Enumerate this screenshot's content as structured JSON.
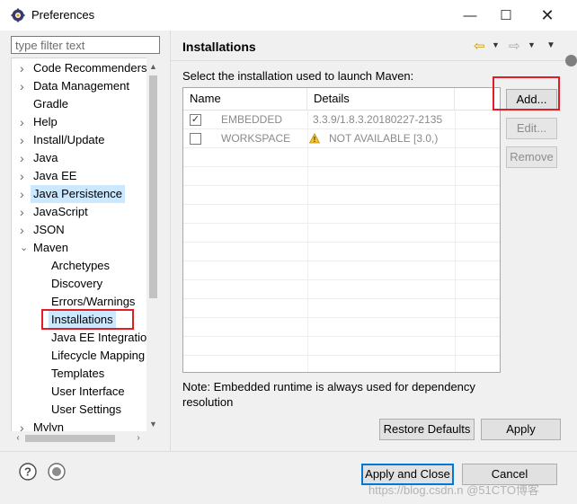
{
  "window": {
    "title": "Preferences",
    "app_icon": "gear-icon",
    "controls": {
      "minimize": "—",
      "maximize": "☐",
      "close": "✕"
    }
  },
  "filter": {
    "placeholder": "type filter text",
    "value": ""
  },
  "tree": {
    "items": [
      {
        "label": "Code Recommenders",
        "level": 0,
        "expandable": true,
        "expanded": false
      },
      {
        "label": "Data Management",
        "level": 0,
        "expandable": true,
        "expanded": false
      },
      {
        "label": "Gradle",
        "level": 0,
        "expandable": false
      },
      {
        "label": "Help",
        "level": 0,
        "expandable": true,
        "expanded": false
      },
      {
        "label": "Install/Update",
        "level": 0,
        "expandable": true,
        "expanded": false
      },
      {
        "label": "Java",
        "level": 0,
        "expandable": true,
        "expanded": false
      },
      {
        "label": "Java EE",
        "level": 0,
        "expandable": true,
        "expanded": false
      },
      {
        "label": "Java Persistence",
        "level": 0,
        "expandable": true,
        "expanded": false,
        "highlighted": true
      },
      {
        "label": "JavaScript",
        "level": 0,
        "expandable": true,
        "expanded": false
      },
      {
        "label": "JSON",
        "level": 0,
        "expandable": true,
        "expanded": false
      },
      {
        "label": "Maven",
        "level": 0,
        "expandable": true,
        "expanded": true
      },
      {
        "label": "Archetypes",
        "level": 1
      },
      {
        "label": "Discovery",
        "level": 1
      },
      {
        "label": "Errors/Warnings",
        "level": 1
      },
      {
        "label": "Installations",
        "level": 1,
        "selected": true
      },
      {
        "label": "Java EE Integration",
        "level": 1
      },
      {
        "label": "Lifecycle Mapping",
        "level": 1
      },
      {
        "label": "Templates",
        "level": 1
      },
      {
        "label": "User Interface",
        "level": 1
      },
      {
        "label": "User Settings",
        "level": 1
      },
      {
        "label": "Mylyn",
        "level": 0,
        "expandable": true,
        "expanded": false
      }
    ]
  },
  "page": {
    "title": "Installations",
    "description": "Select the installation used to launch Maven:",
    "nav": {
      "back_icon": "back-arrow-icon",
      "forward_icon": "forward-arrow-icon",
      "menu_icon": "view-menu-icon"
    }
  },
  "table": {
    "columns": [
      "Name",
      "Details"
    ],
    "rows": [
      {
        "checked": true,
        "name": "EMBEDDED",
        "details": "3.3.9/1.8.3.20180227-2135",
        "warning": false
      },
      {
        "checked": false,
        "name": "WORKSPACE",
        "details": "NOT AVAILABLE [3.0,)",
        "warning": true
      }
    ]
  },
  "side_buttons": {
    "add": "Add...",
    "edit": "Edit...",
    "remove": "Remove"
  },
  "note": "Note: Embedded runtime is always used for dependency resolution",
  "page_buttons": {
    "restore_defaults": "Restore Defaults",
    "apply": "Apply"
  },
  "dialog_buttons": {
    "apply_and_close": "Apply and Close",
    "cancel": "Cancel"
  },
  "watermark": "https://blog.csdn.n @51CTO博客",
  "colors": {
    "selection": "#cce8ff",
    "highlight_box": "#e31d25",
    "default_button_border": "#0078d7",
    "disabled_text": "#8a8a8a"
  }
}
